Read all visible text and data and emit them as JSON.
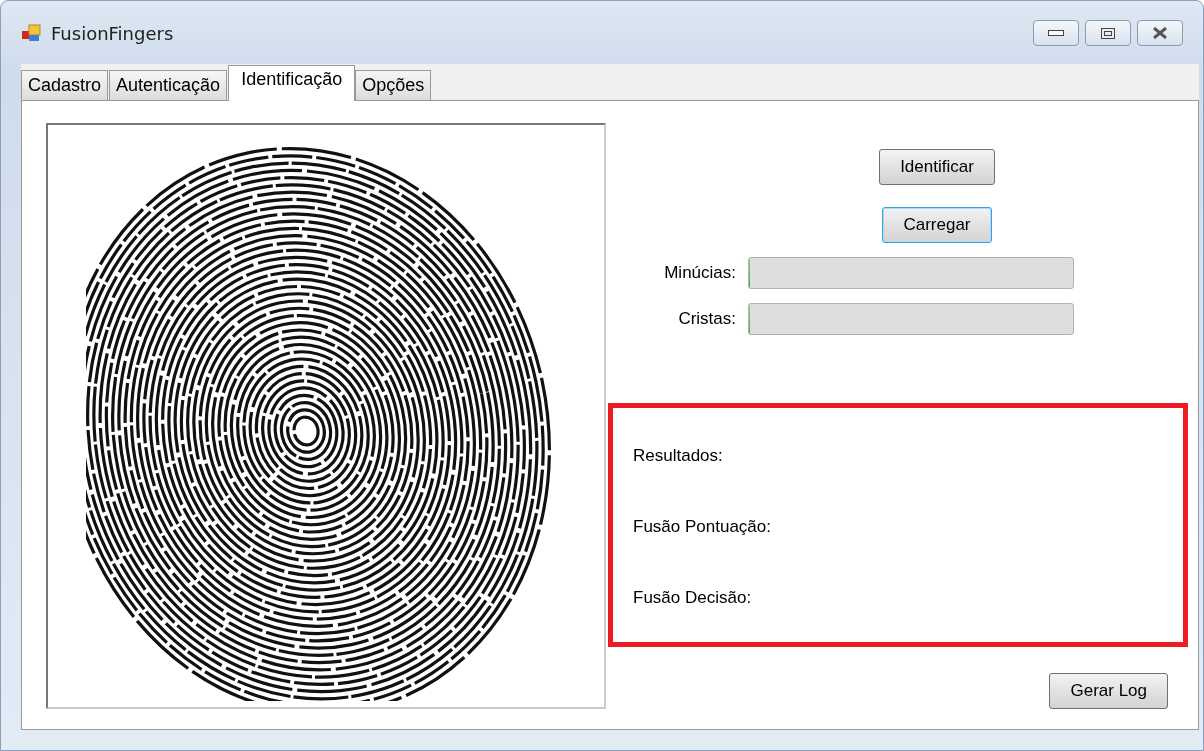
{
  "window": {
    "title": "FusionFingers"
  },
  "tabs": [
    {
      "label": "Cadastro",
      "selected": false
    },
    {
      "label": "Autenticação",
      "selected": false
    },
    {
      "label": "Identificação",
      "selected": true
    },
    {
      "label": "Opções",
      "selected": false
    }
  ],
  "actions": [
    {
      "label": "Identificar",
      "focused": false
    },
    {
      "label": "Carregar",
      "focused": true
    }
  ],
  "meters": [
    {
      "label": "Minúcias:",
      "level": 0
    },
    {
      "label": "Cristas:",
      "level": 0
    }
  ],
  "results": [
    "Resultados:",
    "Fusão Pontuação:",
    "Fusão Decisão:"
  ],
  "log_button": {
    "label": "Gerar Log"
  }
}
